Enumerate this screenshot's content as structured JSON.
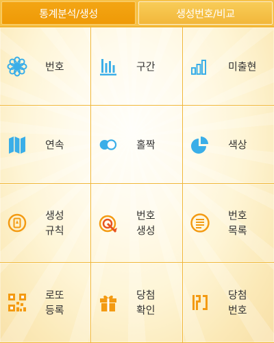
{
  "tabs": [
    {
      "label": "통계분석/생성",
      "active": true
    },
    {
      "label": "생성번호/비교",
      "active": false
    }
  ],
  "menu": [
    {
      "icon": "flower-icon",
      "label": "번호",
      "label2": "",
      "color": "#3aaee8"
    },
    {
      "icon": "bar-chart-icon",
      "label": "구간",
      "label2": "",
      "color": "#3aaee8"
    },
    {
      "icon": "rising-bars-icon",
      "label": "미출현",
      "label2": "",
      "color": "#3aaee8"
    },
    {
      "icon": "map-icon",
      "label": "연속",
      "label2": "",
      "color": "#3aaee8"
    },
    {
      "icon": "toggle-circles-icon",
      "label": "홀짝",
      "label2": "",
      "color": "#3aaee8"
    },
    {
      "icon": "pie-chart-icon",
      "label": "색상",
      "label2": "",
      "color": "#3aaee8"
    },
    {
      "icon": "rule-icon",
      "label": "생성",
      "label2": "규칙",
      "color": "#f39a12"
    },
    {
      "icon": "target-icon",
      "label": "번호",
      "label2": "생성",
      "color": "#f39a12"
    },
    {
      "icon": "list-icon",
      "label": "번호",
      "label2": "목록",
      "color": "#f39a12"
    },
    {
      "icon": "qr-code-icon",
      "label": "로또",
      "label2": "등록",
      "color": "#f39a12"
    },
    {
      "icon": "gift-icon",
      "label": "당첨",
      "label2": "확인",
      "color": "#f39a12"
    },
    {
      "icon": "number-icon",
      "label": "당첨",
      "label2": "번호",
      "color": "#f39a12"
    }
  ]
}
